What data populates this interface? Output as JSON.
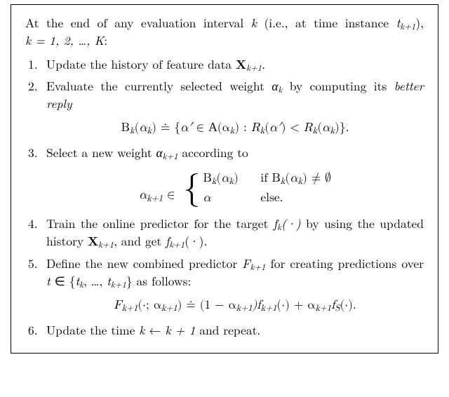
{
  "intro_a": "At the end of any evaluation interval ",
  "intro_b": " (i.e., at time instance ",
  "intro_c": "), ",
  "intro_d": ":",
  "k": "k",
  "t_kp1": "t",
  "k_range": "k = 1, 2, …, K",
  "steps": {
    "1": {
      "a": "Update the history of feature data ",
      "X": "X",
      "Xsub": "k+1",
      "b": "."
    },
    "2": {
      "a": "Evaluate the currently selected weight ",
      "ak": "α",
      "ak_sub": "k",
      "b": " by computing its ",
      "better_reply": "better reply"
    },
    "eq2": {
      "lhs": "B",
      "lhs_sub": "k",
      "arg": "α",
      "arg_sub": "k",
      "doteq": "≐",
      "set_open": "{",
      "ap": "α′",
      "in": " ∈ ",
      "A": "A",
      "A_sub": "(α",
      "A_sub2": "k",
      "A_close": ") : ",
      "R": "R",
      "Rk": "k",
      "lt": " < ",
      "set_close": "}."
    },
    "3": {
      "a": "Select a new weight ",
      "ak1": "α",
      "ak1_sub": "k+1",
      "b": " according to"
    },
    "eq3": {
      "lhs": "α",
      "lhs_sub": "k+1",
      "in": " ∈ ",
      "row1_l": "B",
      "row1_arg": "α",
      "row1_if": "if B",
      "ne": " ≠ ∅",
      "row2_l": "α",
      "row2_else": "else."
    },
    "4": {
      "a": "Train the online predictor for the target ",
      "fk": "f",
      "fk_sub": "k",
      "fk_arg": "(·)",
      "b": " by using the updated history ",
      "X": "X",
      "Xsub": "k+1",
      "c": ", and get ",
      "fk1": "f",
      "fk1_sub": "k+1",
      "d": "(·)."
    },
    "5": {
      "a": "Define the new combined predictor ",
      "F": "F",
      "F_sub": "k+1",
      "b": " for creating predic­tions over ",
      "t": "t",
      "in": " ∈ {",
      "tk": "t",
      "tk_sub": "k",
      "dots": ", …, ",
      "tk1": "t",
      "tk1_sub": "k+1",
      "close": "} as follows:"
    },
    "eq5": {
      "F": "F",
      "F_sub": "k+1",
      "arg": "(·; α",
      "arg_sub": "k+1",
      "close": ") ",
      "doteq": "≐",
      "rhs1": " (1 − α",
      "rhs1_sub": "k+1",
      "rhs2": ")f",
      "rhs2_sub": "k+1",
      "rhs3": "(·) + α",
      "rhs3_sub": "k+1",
      "rhsS": "f",
      "rhsS_sub": "S",
      "rhs_end": "(·)."
    },
    "6": {
      "a": "Update the time ",
      "k": "k",
      "arrow": " ← ",
      "k1": "k + 1",
      "b": " and repeat."
    }
  }
}
